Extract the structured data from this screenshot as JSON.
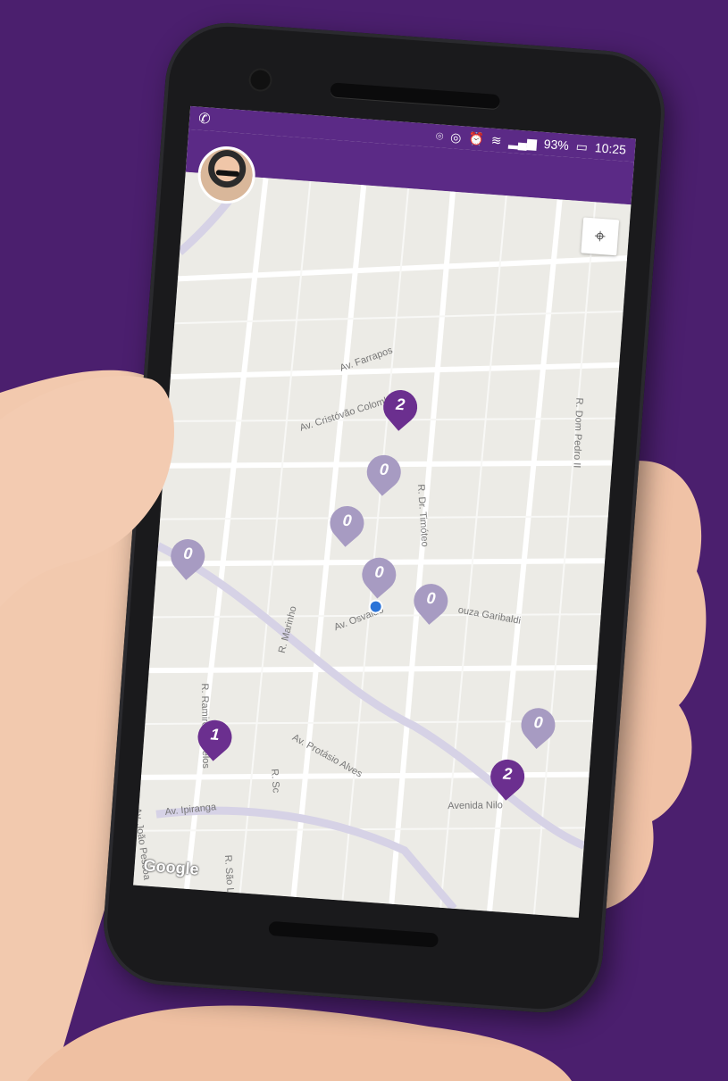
{
  "statusbar": {
    "time": "10:25",
    "battery": "93%",
    "icons": [
      "location-icon",
      "sync-icon",
      "alarm-icon",
      "wifi-icon",
      "signal-icon",
      "battery-icon"
    ]
  },
  "app": {
    "app_icon": "whatsapp-icon",
    "accent_color": "#5b2a86"
  },
  "map": {
    "streets": [
      "Av. Farrapos",
      "Av. Cristóvão Colombo",
      "R. Dr. Timóteo",
      "Av. Osvaldo",
      "ouza Garibaldi",
      "R. Dom Pedro II",
      "R. Ramiro Barcelos",
      "R. Marinho",
      "Av. Protásio Alves",
      "Avenida Nilo",
      "Av. Ipiranga",
      "Av. João Pessoa",
      "R. São Luís",
      "R. Sc"
    ],
    "pins": [
      {
        "count": "2",
        "style": "dark"
      },
      {
        "count": "0",
        "style": "light"
      },
      {
        "count": "0",
        "style": "light"
      },
      {
        "count": "0",
        "style": "light"
      },
      {
        "count": "0",
        "style": "light"
      },
      {
        "count": "0",
        "style": "light"
      },
      {
        "count": "0",
        "style": "light"
      },
      {
        "count": "1",
        "style": "dark"
      },
      {
        "count": "2",
        "style": "dark"
      }
    ],
    "attribution": "Google"
  }
}
